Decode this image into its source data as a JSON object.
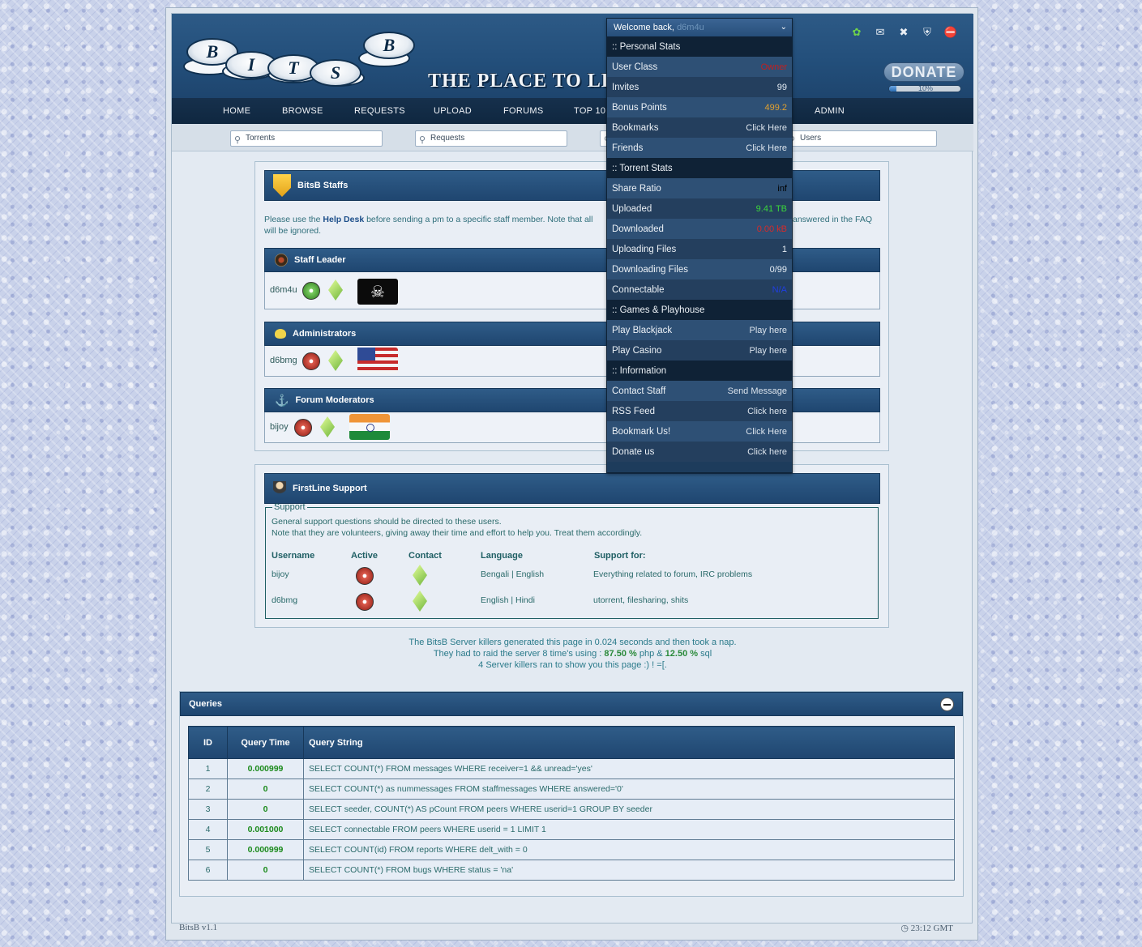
{
  "logo_letters": [
    "B",
    "I",
    "T",
    "S",
    "B"
  ],
  "tagline": "THE PLACE TO LEAR",
  "donate": {
    "label": "DONATE",
    "percent_text": "10%",
    "fraction": 0.1
  },
  "top_icons": [
    "bug-icon",
    "mail-icon",
    "tools-icon",
    "shield-icon",
    "stop-icon"
  ],
  "nav": [
    "HOME",
    "BROWSE",
    "REQUESTS",
    "UPLOAD",
    "FORUMS",
    "TOP 10",
    "ADMIN"
  ],
  "search": {
    "torrents": "Torrents",
    "requests": "Requests",
    "users": "Users"
  },
  "user_menu": {
    "welcome": "Welcome back,",
    "username": "d6m4u",
    "rows": [
      {
        "type": "section",
        "label": ":: Personal Stats"
      },
      {
        "label": "User Class",
        "value": "Owner",
        "color": "#c21f1f"
      },
      {
        "label": "Invites",
        "value": "99",
        "color": "#e6edf4"
      },
      {
        "label": "Bonus Points",
        "value": "499.2",
        "color": "#e0a030"
      },
      {
        "label": "Bookmarks",
        "value": "Click Here",
        "color": "#dbe3ec"
      },
      {
        "label": "Friends",
        "value": "Click Here",
        "color": "#dbe3ec"
      },
      {
        "type": "section",
        "label": ":: Torrent Stats"
      },
      {
        "label": "Share Ratio",
        "value": "inf",
        "color": "#000000"
      },
      {
        "label": "Uploaded",
        "value": "9.41 TB",
        "color": "#3bd63b"
      },
      {
        "label": "Downloaded",
        "value": "0.00 kB",
        "color": "#d62a2a"
      },
      {
        "label": "Uploading Files",
        "value": "1",
        "color": "#e6edf4"
      },
      {
        "label": "Downloading Files",
        "value": "0/99",
        "color": "#e6edf4"
      },
      {
        "label": "Connectable",
        "value": "N/A",
        "color": "#1f3fe0"
      },
      {
        "type": "section",
        "label": ":: Games & Playhouse"
      },
      {
        "label": "Play Blackjack",
        "value": "Play here",
        "color": "#dbe3ec"
      },
      {
        "label": "Play Casino",
        "value": "Play here",
        "color": "#dbe3ec"
      },
      {
        "type": "section",
        "label": ":: Information"
      },
      {
        "label": "Contact Staff",
        "value": "Send Message",
        "color": "#dbe3ec"
      },
      {
        "label": "RSS Feed",
        "value": "Click here",
        "color": "#dbe3ec"
      },
      {
        "label": "Bookmark Us!",
        "value": "Click Here",
        "color": "#dbe3ec"
      },
      {
        "label": "Donate us",
        "value": "Click here",
        "color": "#dbe3ec"
      }
    ]
  },
  "staffs": {
    "title": "BitsB Staffs",
    "notice_pre": "Please use the",
    "notice_link": "Help Desk",
    "notice_mid": "before sending a pm to a specific staff member. Note that all",
    "notice_end": "answered in the FAQ",
    "notice_line2": "will be ignored.",
    "groups": [
      {
        "title": "Staff Leader",
        "user": "d6m4u",
        "status": "online",
        "flag": "pirate-flag"
      },
      {
        "title": "Administrators",
        "user": "d6bmg",
        "status": "offline",
        "flag": "usa-flag"
      },
      {
        "title": "Forum Moderators",
        "user": "bijoy",
        "status": "offline",
        "flag": "india-flag"
      }
    ]
  },
  "support": {
    "title": "FirstLine Support",
    "legend": "Support",
    "line1": "General support questions should be directed to these users.",
    "line2": "Note that they are volunteers, giving away their time and effort to help you. Treat them accordingly.",
    "headers": [
      "Username",
      "Active",
      "Contact",
      "Language",
      "Support for:"
    ],
    "rows": [
      {
        "user": "bijoy",
        "language": "Bengali | English",
        "support": "Everything related to forum, IRC problems"
      },
      {
        "user": "d6bmg",
        "language": "English | Hindi",
        "support": "utorrent, filesharing, shits"
      }
    ]
  },
  "stats": {
    "line1": "The BitsB Server killers generated this page in 0.024 seconds and then took a nap.",
    "line2_pre": "They had to raid the server 8 time's using :",
    "php": "87.50 %",
    "line2_mid": "php &",
    "sql": "12.50 %",
    "line2_end": "sql",
    "line3": "4 Server killers ran to show you this page :) ! =[."
  },
  "queries": {
    "title": "Queries",
    "headers": [
      "ID",
      "Query Time",
      "Query String"
    ],
    "rows": [
      {
        "id": "1",
        "time": "0.000999",
        "query": "SELECT COUNT(*) FROM messages WHERE receiver=1 && unread='yes'"
      },
      {
        "id": "2",
        "time": "0",
        "query": "SELECT COUNT(*) as nummessages FROM staffmessages WHERE answered='0'"
      },
      {
        "id": "3",
        "time": "0",
        "query": "SELECT seeder, COUNT(*) AS pCount FROM peers WHERE userid=1 GROUP BY seeder"
      },
      {
        "id": "4",
        "time": "0.001000",
        "query": "SELECT connectable FROM peers WHERE userid = 1 LIMIT 1"
      },
      {
        "id": "5",
        "time": "0.000999",
        "query": "SELECT COUNT(id) FROM reports WHERE delt_with = 0"
      },
      {
        "id": "6",
        "time": "0",
        "query": "SELECT COUNT(*) FROM bugs WHERE status = 'na'"
      }
    ]
  },
  "footer": {
    "version": "BitsB v1.1",
    "time": "23:12 GMT"
  }
}
